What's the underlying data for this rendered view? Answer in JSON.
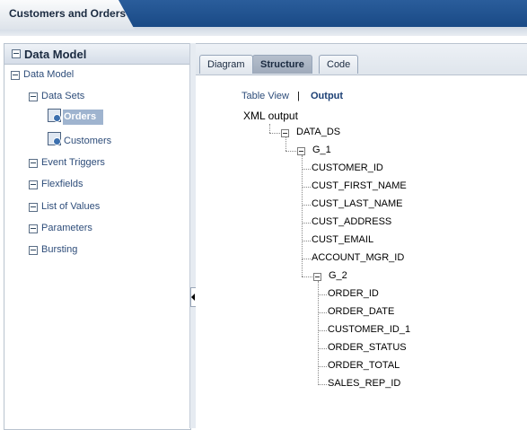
{
  "header": {
    "tab_title": "Customers and Orders"
  },
  "left_panel": {
    "title": "Data Model",
    "root": "Data Model",
    "data_sets_label": "Data Sets",
    "data_sets": [
      "Orders",
      "Customers"
    ],
    "sections": [
      "Event Triggers",
      "Flexfields",
      "List of Values",
      "Parameters",
      "Bursting"
    ]
  },
  "tabs": [
    {
      "label": "Diagram",
      "active": false
    },
    {
      "label": "Structure",
      "active": true
    },
    {
      "label": "Code",
      "active": false
    }
  ],
  "view_links": {
    "table_view": "Table View",
    "separator": "|",
    "output": "Output"
  },
  "xml": {
    "root_label": "XML output",
    "data_ds": "DATA_DS",
    "g1": "G_1",
    "g1_fields": [
      "CUSTOMER_ID",
      "CUST_FIRST_NAME",
      "CUST_LAST_NAME",
      "CUST_ADDRESS",
      "CUST_EMAIL",
      "ACCOUNT_MGR_ID"
    ],
    "g2": "G_2",
    "g2_fields": [
      "ORDER_ID",
      "ORDER_DATE",
      "CUSTOMER_ID_1",
      "ORDER_STATUS",
      "ORDER_TOTAL",
      "SALES_REP_ID"
    ]
  }
}
